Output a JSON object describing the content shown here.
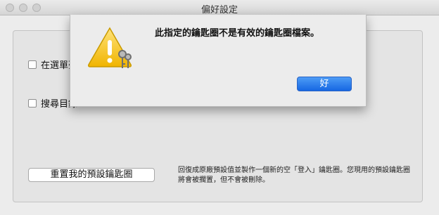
{
  "window": {
    "title": "偏好設定"
  },
  "preferences": {
    "checkbox1_label": "在選單列",
    "checkbox2_label": "搜尋目錄",
    "reset_button_label": "重置我的預設鑰匙圈",
    "reset_description_line1": "回復成原廠預設值並製作一個新的空「登入」鑰匙圈。您現用的預設鑰匙圈",
    "reset_description_line2": "將會被擱置，但不會被刪除。"
  },
  "alert": {
    "message": "此指定的鑰匙圈不是有效的鑰匙圈檔案。",
    "ok_label": "好",
    "icon": "warning-keychain-icon"
  },
  "colors": {
    "accent": "#1667e3",
    "warning": "#f5c400"
  }
}
